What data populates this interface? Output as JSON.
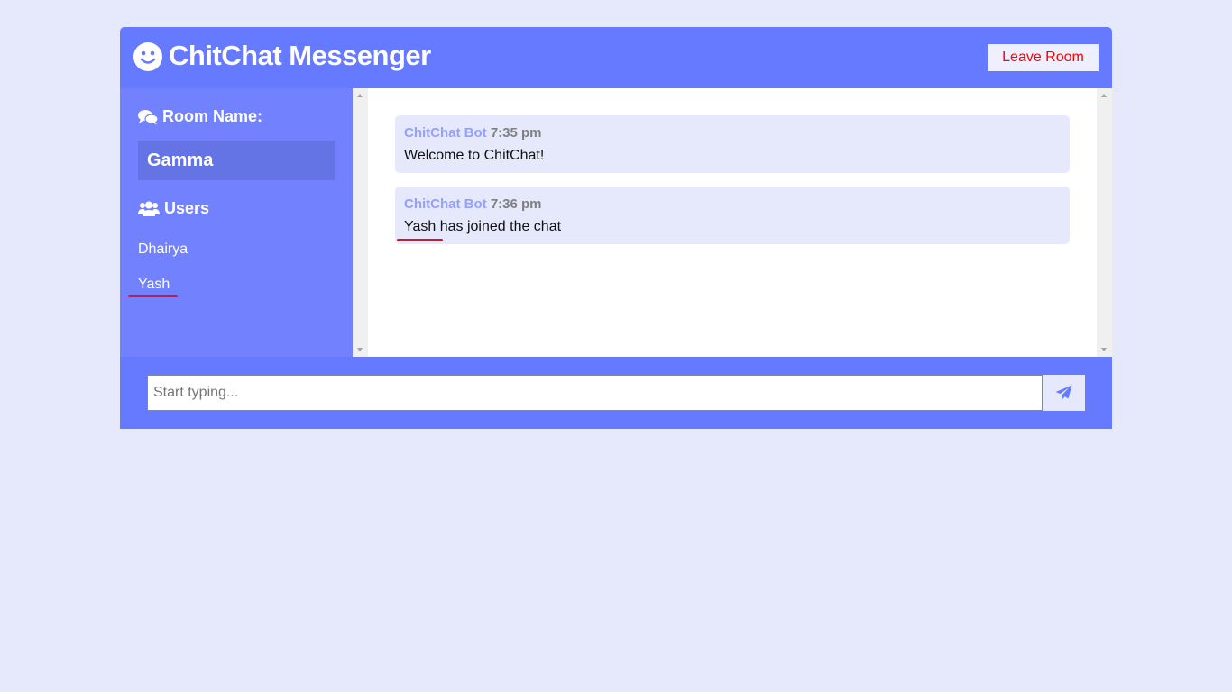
{
  "header": {
    "title": "ChitChat Messenger",
    "logo_icon": "smiley-icon",
    "leave_label": "Leave Room"
  },
  "sidebar": {
    "room_heading": "Room Name:",
    "room_name": "Gamma",
    "users_heading": "Users",
    "users": [
      "Dhairya",
      "Yash"
    ]
  },
  "messages": [
    {
      "author": "ChitChat Bot",
      "time": "7:35 pm",
      "text": "Welcome to ChitChat!"
    },
    {
      "author": "ChitChat Bot",
      "time": "7:36 pm",
      "text": "Yash has joined the chat"
    }
  ],
  "composer": {
    "placeholder": "Start typing...",
    "send_icon": "paper-plane-icon"
  },
  "colors": {
    "page_bg": "#e6e9fc",
    "header_bg": "#667aff",
    "sidebar_bg": "#7282ff",
    "room_box_bg": "#6474e5",
    "leave_text": "#ff0000",
    "annotation_underline": "#e0112b"
  }
}
